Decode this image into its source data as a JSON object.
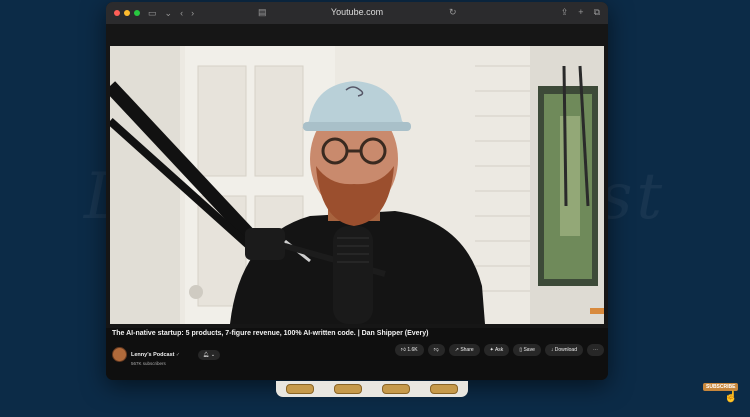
{
  "background": {
    "watermark_text": "Lenny's Podcast"
  },
  "browser": {
    "url": "Youtube.com",
    "icons": [
      "sidebar-icon",
      "back-icon",
      "forward-icon",
      "reader-icon",
      "reload-icon",
      "share-icon",
      "new-tab-icon",
      "tabs-icon"
    ]
  },
  "video": {
    "title": "The AI-native startup: 5 products, 7-figure revenue, 100% AI-written code. | Dan Shipper (Every)",
    "channel_name": "Lenny's Podcast",
    "verified_icon": "verified-icon",
    "subscribers": "567K subscribers",
    "likes": "1.6K",
    "actions": {
      "share": "Share",
      "ask": "Ask",
      "save": "Save",
      "download": "Download"
    }
  },
  "overlay": {
    "subscribe_label": "SUBSCRIBE"
  }
}
